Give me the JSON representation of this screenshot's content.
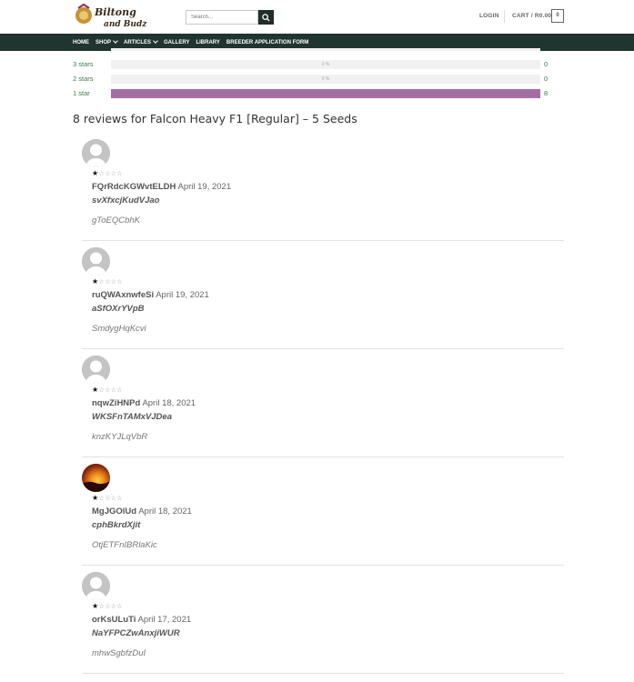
{
  "header": {
    "logo_text_line1": "Biltong",
    "logo_text_line2": "and Budz",
    "search_placeholder": "Search...",
    "login_label": "LOGIN",
    "cart_label": "CART / R0.00",
    "cart_count": "0",
    "nav": [
      {
        "label": "HOME",
        "has_dropdown": false
      },
      {
        "label": "SHOP",
        "has_dropdown": true
      },
      {
        "label": "ARTICLES",
        "has_dropdown": true
      },
      {
        "label": "GALLERY",
        "has_dropdown": false
      },
      {
        "label": "LIBRARY",
        "has_dropdown": false
      },
      {
        "label": "BREEDER APPLICATION FORM",
        "has_dropdown": false
      }
    ],
    "nav_bg": "#203430"
  },
  "ratings": {
    "bar_color": "#a66da4",
    "rows": [
      {
        "label": "3 stars",
        "percent_text": "0 %",
        "count": "0",
        "fraction": 0
      },
      {
        "label": "2 stars",
        "percent_text": "0 %",
        "count": "0",
        "fraction": 0
      },
      {
        "label": "1 star",
        "percent_text": "",
        "count": "8",
        "fraction": 1
      }
    ]
  },
  "reviews_heading": "8 reviews for Falcon Heavy F1 [Regular] – 5 Seeds",
  "reviews": [
    {
      "author": "FQrRdcKGWvtELDH",
      "date": "April 19, 2021",
      "title": "svXfxcjKudVJao",
      "text": "gToEQCbhK",
      "rating": 1,
      "avatar": "default"
    },
    {
      "author": "ruQWAxnwfeSi",
      "date": "April 19, 2021",
      "title": "aSfOXrYVpB",
      "text": "SmdygHqKcvi",
      "rating": 1,
      "avatar": "default"
    },
    {
      "author": "nqwZiHNPd",
      "date": "April 18, 2021",
      "title": "WKSFnTAMxVJDea",
      "text": "knzKYJLqVbR",
      "rating": 1,
      "avatar": "default"
    },
    {
      "author": "MgJGOlUd",
      "date": "April 18, 2021",
      "title": "cphBkrdXjit",
      "text": "OtjETFnIBRlaKic",
      "rating": 1,
      "avatar": "photo"
    },
    {
      "author": "orKsULuTi",
      "date": "April 17, 2021",
      "title": "NaYFPCZwAnxjiWUR",
      "text": "mhwSgbfzDuI",
      "rating": 1,
      "avatar": "default"
    }
  ]
}
